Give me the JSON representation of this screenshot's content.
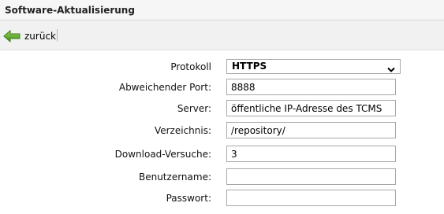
{
  "window": {
    "title": "Software-Aktualisierung"
  },
  "toolbar": {
    "back_label": "zurück",
    "back_icon": "arrow-left-green-icon",
    "accent_color": "#5fae2a"
  },
  "form": {
    "protokoll": {
      "label": "Protokoll",
      "value": "HTTPS"
    },
    "port": {
      "label": "Abweichender Port:",
      "value": "8888"
    },
    "server": {
      "label": "Server:",
      "value": "öffentliche IP-Adresse des TCMS"
    },
    "verzeichnis": {
      "label": "Verzeichnis:",
      "value": "/repository/"
    },
    "download_versuche": {
      "label": "Download-Versuche:",
      "value": "3"
    },
    "benutzername": {
      "label": "Benutzername:",
      "value": ""
    },
    "passwort": {
      "label": "Passwort:",
      "value": ""
    }
  }
}
